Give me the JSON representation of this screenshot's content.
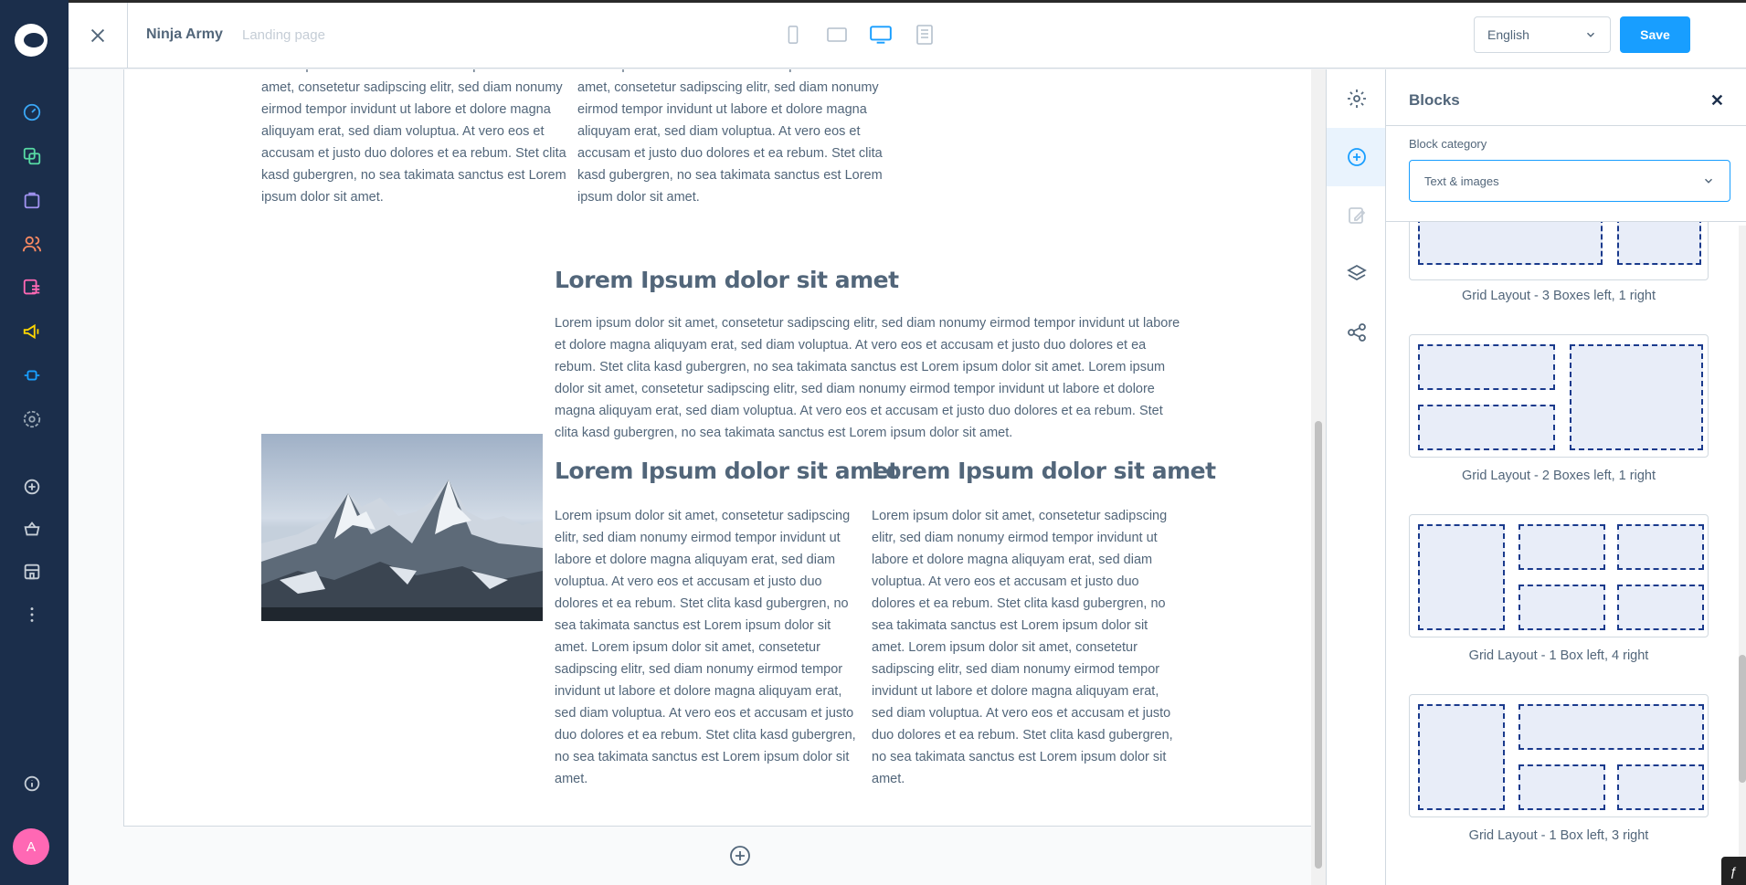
{
  "topbar": {
    "page_name": "Ninja Army",
    "page_type": "Landing page",
    "language": "English",
    "save_label": "Save"
  },
  "nav": {
    "avatar_initial": "A"
  },
  "content": {
    "top_col_text": "Lorem ipsum dolor sit amet. Lorem ipsum dolor sit amet, consetetur sadipscing elitr, sed diam nonumy eirmod tempor invidunt ut labore et dolore magna aliquyam erat, sed diam voluptua. At vero eos et accusam et justo duo dolores et ea rebum. Stet clita kasd gubergren, no sea takimata sanctus est Lorem ipsum dolor sit amet.",
    "heading_main": "Lorem Ipsum dolor sit amet",
    "main_text": "Lorem ipsum dolor sit amet, consetetur sadipscing elitr, sed diam nonumy eirmod tempor invidunt ut labore et dolore magna aliquyam erat, sed diam voluptua. At vero eos et accusam et justo duo dolores et ea rebum. Stet clita kasd gubergren, no sea takimata sanctus est Lorem ipsum dolor sit amet. Lorem ipsum dolor sit amet, consetetur sadipscing elitr, sed diam nonumy eirmod tempor invidunt ut labore et dolore magna aliquyam erat, sed diam voluptua. At vero eos et accusam et justo duo dolores et ea rebum. Stet clita kasd gubergren, no sea takimata sanctus est Lorem ipsum dolor sit amet.",
    "heading_col1": "Lorem Ipsum dolor sit amet",
    "heading_col2": "Lorem Ipsum dolor sit amet",
    "col_text": "Lorem ipsum dolor sit amet, consetetur sadipscing elitr, sed diam nonumy eirmod tempor invidunt ut labore et dolore magna aliquyam erat, sed diam voluptua. At vero eos et accusam et justo duo dolores et ea rebum. Stet clita kasd gubergren, no sea takimata sanctus est Lorem ipsum dolor sit amet. Lorem ipsum dolor sit amet, consetetur sadipscing elitr, sed diam nonumy eirmod tempor invidunt ut labore et dolore magna aliquyam erat, sed diam voluptua. At vero eos et accusam et justo duo dolores et ea rebum. Stet clita kasd gubergren, no sea takimata sanctus est Lorem ipsum dolor sit amet."
  },
  "panel": {
    "title": "Blocks",
    "category_label": "Block category",
    "category_value": "Text & images",
    "blocks": [
      "Grid Layout - 3 Boxes left, 1 right",
      "Grid Layout - 2 Boxes left, 1 right",
      "Grid Layout - 1 Box left, 4 right",
      "Grid Layout - 1 Box left, 3 right"
    ]
  },
  "colors": {
    "nav_bg": "#1b2e4b",
    "accent": "#189eff",
    "box_border": "#1a3a8c",
    "avatar": "#ff68b4"
  },
  "icons": [
    "logo",
    "dashboard-icon",
    "catalogue-icon",
    "orders-icon",
    "customers-icon",
    "content-icon",
    "marketing-icon",
    "extensions-icon",
    "settings-icon",
    "add-icon",
    "basket-icon",
    "store-icon",
    "more-icon",
    "help-icon"
  ]
}
